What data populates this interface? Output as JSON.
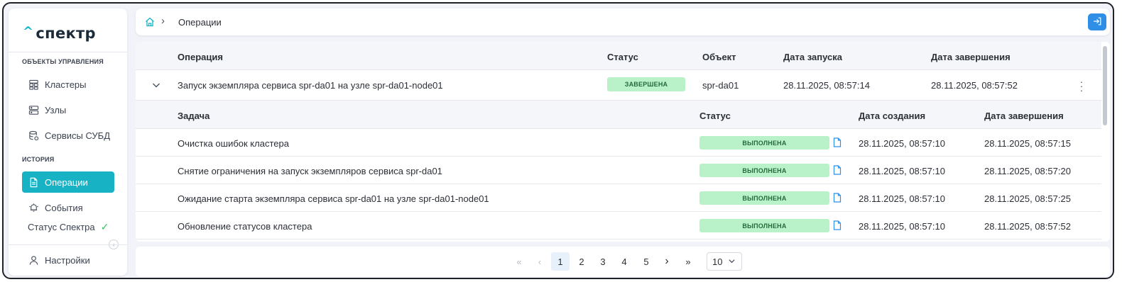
{
  "app": {
    "logo_text": "спектр",
    "logo_caret": "^"
  },
  "sidebar": {
    "section_objects": "ОБЪЕКТЫ УПРАВЛЕНИЯ",
    "items_objects": [
      {
        "label": "Кластеры",
        "icon": "clusters-icon"
      },
      {
        "label": "Узлы",
        "icon": "nodes-icon"
      },
      {
        "label": "Сервисы СУБД",
        "icon": "db-services-icon"
      }
    ],
    "section_history": "ИСТОРИЯ",
    "items_history": [
      {
        "label": "Операции",
        "icon": "document-icon",
        "active": true
      },
      {
        "label": "События",
        "icon": "events-icon"
      }
    ],
    "status_label": "Статус Спектра",
    "status_icon": "check-icon",
    "settings_label": "Настройки"
  },
  "header": {
    "breadcrumb_current": "Операции",
    "home_icon": "home-icon",
    "logout_icon": "logout-icon"
  },
  "operations_table": {
    "columns": {
      "operation": "Операция",
      "status": "Статус",
      "object": "Объект",
      "start_date": "Дата запуска",
      "end_date": "Дата завершения"
    },
    "rows": [
      {
        "operation": "Запуск экземпляра сервиса spr-da01 на узле spr-da01-node01",
        "status": "ЗАВЕРШЕНА",
        "object": "spr-da01",
        "start_date": "28.11.2025, 08:57:14",
        "end_date": "28.11.2025, 08:57:52",
        "expanded": true
      }
    ]
  },
  "tasks_table": {
    "columns": {
      "task": "Задача",
      "status": "Статус",
      "created": "Дата создания",
      "finished": "Дата завершения"
    },
    "rows": [
      {
        "task": "Очистка ошибок кластера",
        "status": "ВЫПОЛНЕНА",
        "created": "28.11.2025, 08:57:10",
        "finished": "28.11.2025, 08:57:15"
      },
      {
        "task": "Снятие ограничения на запуск экземпляров сервиса spr-da01",
        "status": "ВЫПОЛНЕНА",
        "created": "28.11.2025, 08:57:10",
        "finished": "28.11.2025, 08:57:20"
      },
      {
        "task": "Ожидание старта экземпляра сервиса spr-da01 на узле spr-da01-node01",
        "status": "ВЫПОЛНЕНА",
        "created": "28.11.2025, 08:57:10",
        "finished": "28.11.2025, 08:57:25"
      },
      {
        "task": "Обновление статусов кластера",
        "status": "ВЫПОЛНЕНА",
        "created": "28.11.2025, 08:57:10",
        "finished": "28.11.2025, 08:57:52"
      }
    ]
  },
  "pagination": {
    "first": "«",
    "prev": "‹",
    "pages": [
      "1",
      "2",
      "3",
      "4",
      "5"
    ],
    "current_page": "1",
    "next": "›",
    "last": "»",
    "page_size": "10"
  },
  "colors": {
    "accent": "#17b3c5",
    "primary_button": "#2f8fe6",
    "success_badge_bg": "#b9f2c8",
    "success_badge_text": "#256b3a",
    "background": "#f1f3f8"
  }
}
